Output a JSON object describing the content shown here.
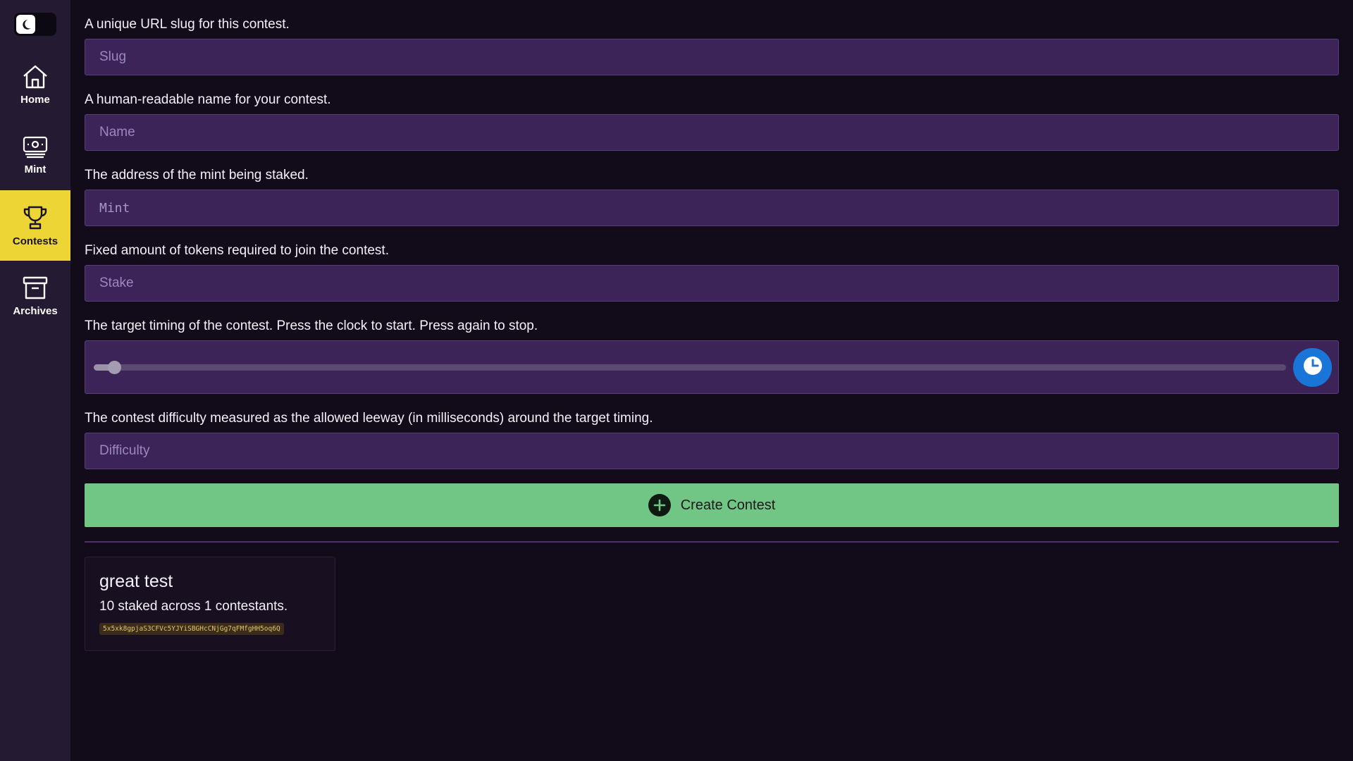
{
  "sidebar": {
    "theme_toggle_icon": "moon-icon",
    "items": [
      {
        "label": "Home",
        "icon": "home-icon",
        "active": false
      },
      {
        "label": "Mint",
        "icon": "banknote-icon",
        "active": false
      },
      {
        "label": "Contests",
        "icon": "trophy-icon",
        "active": true
      },
      {
        "label": "Archives",
        "icon": "archive-icon",
        "active": false
      }
    ],
    "accent_color": "#ecd535"
  },
  "form": {
    "slug": {
      "label": "A unique URL slug for this contest.",
      "placeholder": "Slug",
      "value": ""
    },
    "name": {
      "label": "A human-readable name for your contest.",
      "placeholder": "Name",
      "value": ""
    },
    "mint": {
      "label": "The address of the mint being staked.",
      "placeholder": "Mint",
      "value": ""
    },
    "stake": {
      "label": "Fixed amount of tokens required to join the contest.",
      "placeholder": "Stake",
      "value": ""
    },
    "timing": {
      "label": "The target timing of the contest. Press the clock to start. Press again to stop.",
      "slider_value": 0.017,
      "clock_icon": "clock-icon"
    },
    "difficulty": {
      "label": "The contest difficulty measured as the allowed leeway (in milliseconds) around the target timing.",
      "placeholder": "Difficulty",
      "value": ""
    },
    "submit": {
      "label": "Create Contest",
      "icon": "plus-circle-icon",
      "color": "#72c685"
    }
  },
  "contests": [
    {
      "title": "great test",
      "description": "10 staked across 1 contestants.",
      "address": "5x5xk8gpjaS3CFVc5YJYiSBGHcCNjGg7qFMfgHH5oq6Q"
    }
  ]
}
